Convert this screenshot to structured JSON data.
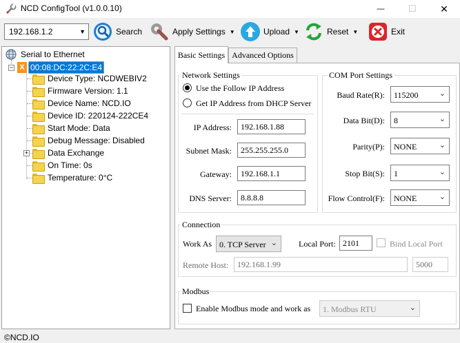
{
  "window": {
    "title": "NCD ConfigTool (v1.0.0.10)",
    "minimize_glyph": "—",
    "maximize_glyph": "☐",
    "close_glyph": "✕"
  },
  "toolbar": {
    "ip_address": "192.168.1.2",
    "search_label": "Search",
    "apply_settings_label": "Apply Settings",
    "upload_label": "Upload",
    "reset_label": "Reset",
    "exit_label": "Exit",
    "dropdown_glyph": "▼",
    "colors": {
      "search": "#1a7fd4",
      "upload": "#29a9e0",
      "reset": "#23a33a",
      "exit": "#d9262b"
    }
  },
  "tree": {
    "root_label": "Serial to Ethernet",
    "device_label": "00:08:DC:22:2C:E4",
    "device_icon_text": "X",
    "items": [
      {
        "label": "Device Type: NCDWEBIV2",
        "expandable": false
      },
      {
        "label": "Firmware Version: 1.1",
        "expandable": false
      },
      {
        "label": "Device Name: NCD.IO",
        "expandable": false
      },
      {
        "label": "Device ID: 220124-222CE4",
        "expandable": false
      },
      {
        "label": "Start Mode: Data",
        "expandable": false
      },
      {
        "label": "Debug Message: Disabled",
        "expandable": false
      },
      {
        "label": "Data Exchange",
        "expandable": true
      },
      {
        "label": "On Time: 0s",
        "expandable": false
      },
      {
        "label": "Temperature: 0°C",
        "expandable": false
      }
    ],
    "selected_color": "#0078d7"
  },
  "tabs": [
    {
      "label": "Basic Settings",
      "active": true
    },
    {
      "label": "Advanced Options",
      "active": false
    }
  ],
  "network": {
    "title": "Network Settings",
    "radio_static": "Use the Follow IP Address",
    "radio_dhcp": "Get IP Address from DHCP Server",
    "ip_label": "IP Address:",
    "ip_value": "192.168.1.88",
    "subnet_label": "Subnet Mask:",
    "subnet_value": "255.255.255.0",
    "gateway_label": "Gateway:",
    "gateway_value": "192.168.1.1",
    "dns_label": "DNS Server:",
    "dns_value": "8.8.8.8"
  },
  "com": {
    "title": "COM Port Settings",
    "baud_label": "Baud Rate(R):",
    "baud_value": "115200",
    "databit_label": "Data Bit(D):",
    "databit_value": "8",
    "parity_label": "Parity(P):",
    "parity_value": "NONE",
    "stopbit_label": "Stop Bit(S):",
    "stopbit_value": "1",
    "flow_label": "Flow Control(F):",
    "flow_value": "NONE"
  },
  "connection": {
    "title": "Connection",
    "work_as_label": "Work As",
    "work_as_value": "0. TCP Server",
    "local_port_label": "Local Port:",
    "local_port_value": "2101",
    "bind_local_port_label": "Bind Local Port",
    "remote_host_label": "Remote Host:",
    "remote_host_value": "192.168.1.99",
    "remote_port_value": "5000"
  },
  "modbus": {
    "title": "Modbus",
    "enable_label": "Enable Modbus mode and work as",
    "mode_value": "1. Modbus RTU"
  },
  "status": {
    "text": "©NCD.IO"
  }
}
